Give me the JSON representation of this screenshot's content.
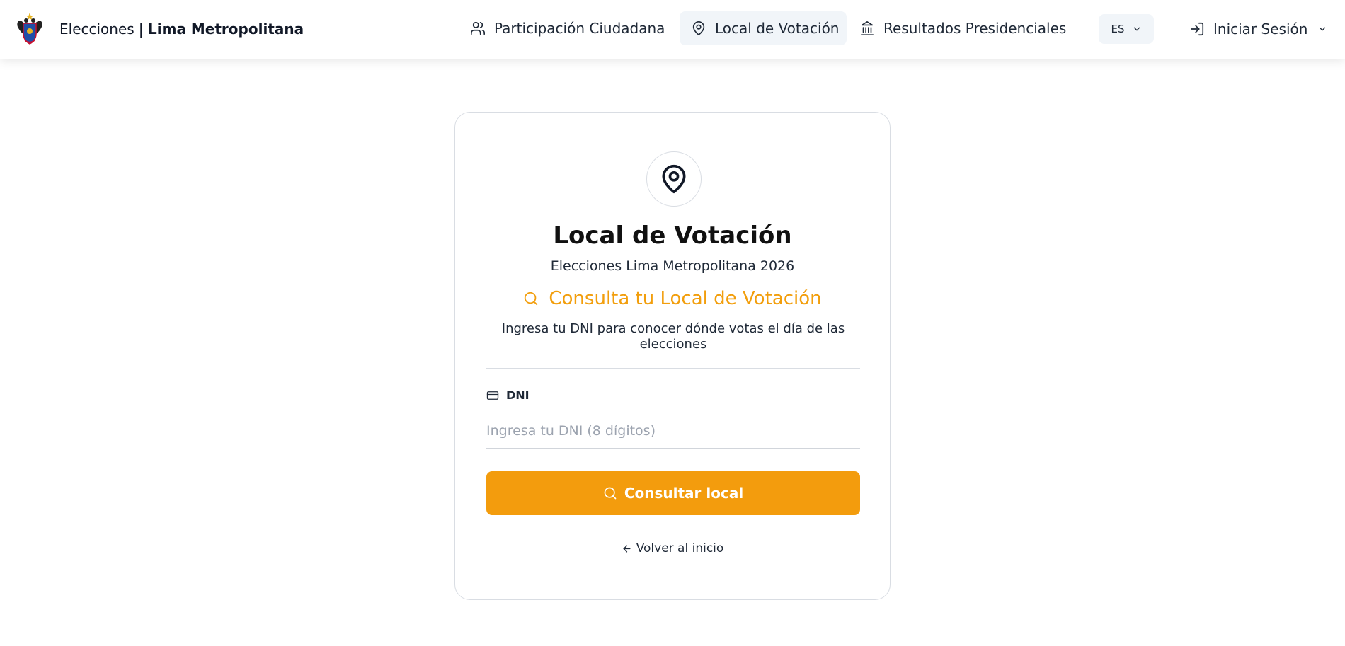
{
  "header": {
    "brand": {
      "prefix": "Elecciones",
      "separator": "|",
      "city": "Lima Metropolitana",
      "logo_icon": "lima-coat-of-arms-icon"
    },
    "nav": [
      {
        "label": "Participación Ciudadana",
        "icon": "users-icon",
        "active": false
      },
      {
        "label": "Local de Votación",
        "icon": "map-pin-icon",
        "active": true
      },
      {
        "label": "Resultados Presidenciales",
        "icon": "landmark-icon",
        "active": false
      }
    ],
    "language": {
      "selected": "ES",
      "icon": "chevron-down-icon"
    },
    "login": {
      "label": "Iniciar Sesión",
      "icon": "log-in-icon"
    }
  },
  "card": {
    "icon": "map-pin-icon",
    "title": "Local de Votación",
    "subtitle": "Elecciones Lima Metropolitana 2026",
    "consulta_title": "Consulta tu Local de Votación",
    "consulta_description": "Ingresa tu DNI para conocer dónde votas el día de las elecciones",
    "dni": {
      "label": "DNI",
      "icon": "id-card-icon",
      "value": "",
      "placeholder": "Ingresa tu DNI (8 dígitos)"
    },
    "submit_label": "Consultar local",
    "back_label": "Volver al inicio"
  },
  "colors": {
    "accent": "#f39c0d",
    "accent_text": "#f29e0c",
    "active_nav_bg": "#f1f5f9",
    "border": "#d9dde3"
  }
}
